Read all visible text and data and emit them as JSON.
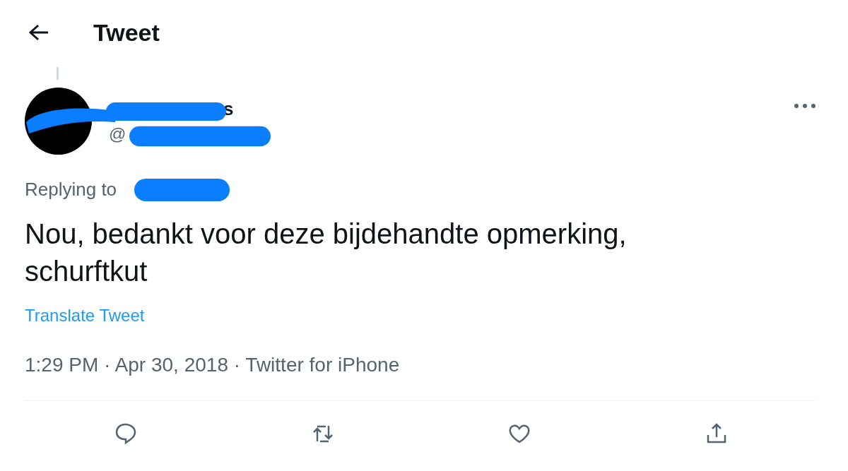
{
  "header": {
    "title": "Tweet"
  },
  "tweet": {
    "author_name_visible": "s",
    "handle_visible": "@",
    "replying_to": "Replying to",
    "text": "Nou, bedankt voor deze bijdehandte opmerking, schurftkut",
    "translate_link": "Translate Tweet",
    "timestamp": "1:29 PM · Apr 30, 2018 · Twitter for iPhone"
  },
  "actions": [
    {
      "kind": "reply"
    },
    {
      "kind": "retweet"
    },
    {
      "kind": "like"
    },
    {
      "kind": "share"
    }
  ]
}
